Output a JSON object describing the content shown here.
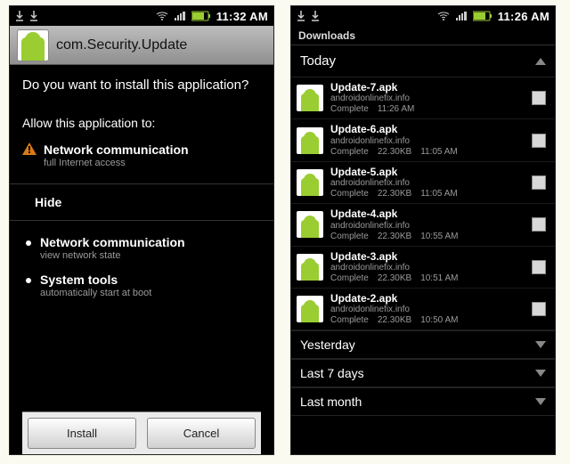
{
  "left": {
    "status_time": "11:32 AM",
    "app_title": "com.Security.Update",
    "question": "Do you want to install this application?",
    "allow_label": "Allow this application to:",
    "primary_perm": {
      "title": "Network communication",
      "sub": "full Internet access"
    },
    "hide_label": "Hide",
    "extra_perms": [
      {
        "title": "Network communication",
        "sub": "view network state"
      },
      {
        "title": "System tools",
        "sub": "automatically start at boot"
      }
    ],
    "install_label": "Install",
    "cancel_label": "Cancel"
  },
  "right": {
    "status_time": "11:26 AM",
    "screen_title": "Downloads",
    "section_today": "Today",
    "items": [
      {
        "name": "Update-7.apk",
        "source": "androidonlinefix.info",
        "status": "Complete",
        "size": "",
        "time": "11:26 AM"
      },
      {
        "name": "Update-6.apk",
        "source": "androidonlinefix.info",
        "status": "Complete",
        "size": "22.30KB",
        "time": "11:05 AM"
      },
      {
        "name": "Update-5.apk",
        "source": "androidonlinefix.info",
        "status": "Complete",
        "size": "22.30KB",
        "time": "11:05 AM"
      },
      {
        "name": "Update-4.apk",
        "source": "androidonlinefix.info",
        "status": "Complete",
        "size": "22.30KB",
        "time": "10:55 AM"
      },
      {
        "name": "Update-3.apk",
        "source": "androidonlinefix.info",
        "status": "Complete",
        "size": "22.30KB",
        "time": "10:51 AM"
      },
      {
        "name": "Update-2.apk",
        "source": "androidonlinefix.info",
        "status": "Complete",
        "size": "22.30KB",
        "time": "10:50 AM"
      }
    ],
    "section_yesterday": "Yesterday",
    "section_last7": "Last 7 days",
    "section_lastmonth": "Last month"
  }
}
